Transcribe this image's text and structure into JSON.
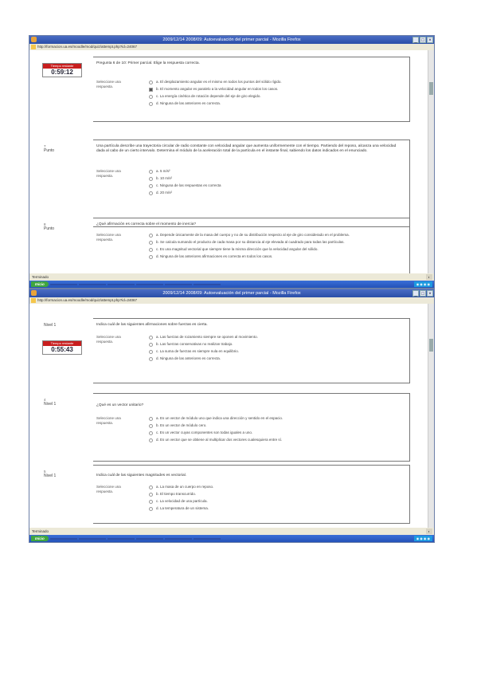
{
  "shot1": {
    "title": "2009/12/14 2008/09: Autoevaluación del primer parcial - Mozilla Firefox",
    "address": "http://formacion.ua.es/moodle/mod/quiz/attempt.php?id=24067",
    "timer": {
      "label": "Tiempo restante",
      "value": "0:59:12"
    },
    "status": "Terminado",
    "tasks": [
      "Inicio",
      "",
      "",
      "",
      "",
      "",
      "",
      ""
    ],
    "questions": [
      {
        "label": "",
        "number": "",
        "text": "Pregunta 6 de 10: Primer parcial. Elige la respuesta correcta.",
        "select_label": "Seleccione una respuesta.",
        "options": [
          "a. El desplazamiento angular es el mismo en todos los puntos del sólido rígido.",
          "b. El momento angular es paralelo a la velocidad angular en todos los casos.",
          "c. La energía cinética de rotación depende del eje de giro elegido.",
          "d. Ninguna de las anteriores es correcta."
        ],
        "checked": 1
      },
      {
        "label": "Punto",
        "number": "7",
        "text": "Una partícula describe una trayectoria circular de radio constante con velocidad angular que aumenta uniformemente con el tiempo. Partiendo del reposo, alcanza una velocidad dada al cabo de un cierto intervalo. Determina el módulo de la aceleración total de la partícula en el instante final, sabiendo los datos indicados en el enunciado.",
        "select_label": "Seleccione una respuesta.",
        "options": [
          "a. 5 m/s²",
          "b. 10 m/s²",
          "c. Ninguna de las respuestas es correcta",
          "d. 20 m/s²"
        ],
        "checked": -1
      },
      {
        "label": "Punto",
        "number": "8",
        "text": "¿Qué afirmación es correcta sobre el momento de inercia?",
        "select_label": "Seleccione una respuesta.",
        "options": [
          "a. Depende únicamente de la masa del cuerpo y no de su distribución respecto al eje de giro considerado en el problema.",
          "b. Se calcula sumando el producto de cada masa por su distancia al eje elevada al cuadrado para todas las partículas.",
          "c. Es una magnitud vectorial que siempre tiene la misma dirección que la velocidad angular del sólido.",
          "d. Ninguna de las anteriores afirmaciones es correcta en todos los casos."
        ],
        "checked": -1
      }
    ]
  },
  "shot2": {
    "title": "2009/12/14 2008/09: Autoevaluación del primer parcial - Mozilla Firefox",
    "address": "http://formacion.ua.es/moodle/mod/quiz/attempt.php?id=24067",
    "timer": {
      "label": "Tiempo restante",
      "value": "0:55:43"
    },
    "status": "Terminado",
    "tasks": [
      "Inicio",
      "",
      "",
      "",
      "",
      "",
      "",
      ""
    ],
    "questions": [
      {
        "label": "Nivel 1",
        "number": "",
        "text": "Indica cuál de las siguientes afirmaciones sobre fuerzas es cierta.",
        "select_label": "Seleccione una respuesta.",
        "options": [
          "a. Las fuerzas de rozamiento siempre se oponen al movimiento.",
          "b. Las fuerzas conservativas no realizan trabajo.",
          "c. La suma de fuerzas es siempre nula en equilibrio.",
          "d. Ninguna de las anteriores es correcta."
        ],
        "checked": -1
      },
      {
        "label": "Nivel 1",
        "number": "4",
        "text": "¿Qué es un vector unitario?",
        "select_label": "Seleccione una respuesta.",
        "options": [
          "a. Es un vector de módulo uno que indica una dirección y sentido en el espacio.",
          "b. Es un vector de módulo cero.",
          "c. Es un vector cuyas componentes son todas iguales a uno.",
          "d. Es un vector que se obtiene al multiplicar dos vectores cualesquiera entre sí."
        ],
        "checked": -1
      },
      {
        "label": "Nivel 1",
        "number": "5",
        "text": "Indica cuál de las siguientes magnitudes es vectorial.",
        "select_label": "Seleccione una respuesta.",
        "options": [
          "a. La masa de un cuerpo en reposo.",
          "b. El tiempo transcurrido.",
          "c. La velocidad de una partícula.",
          "d. La temperatura de un sistema."
        ],
        "checked": -1
      }
    ]
  }
}
